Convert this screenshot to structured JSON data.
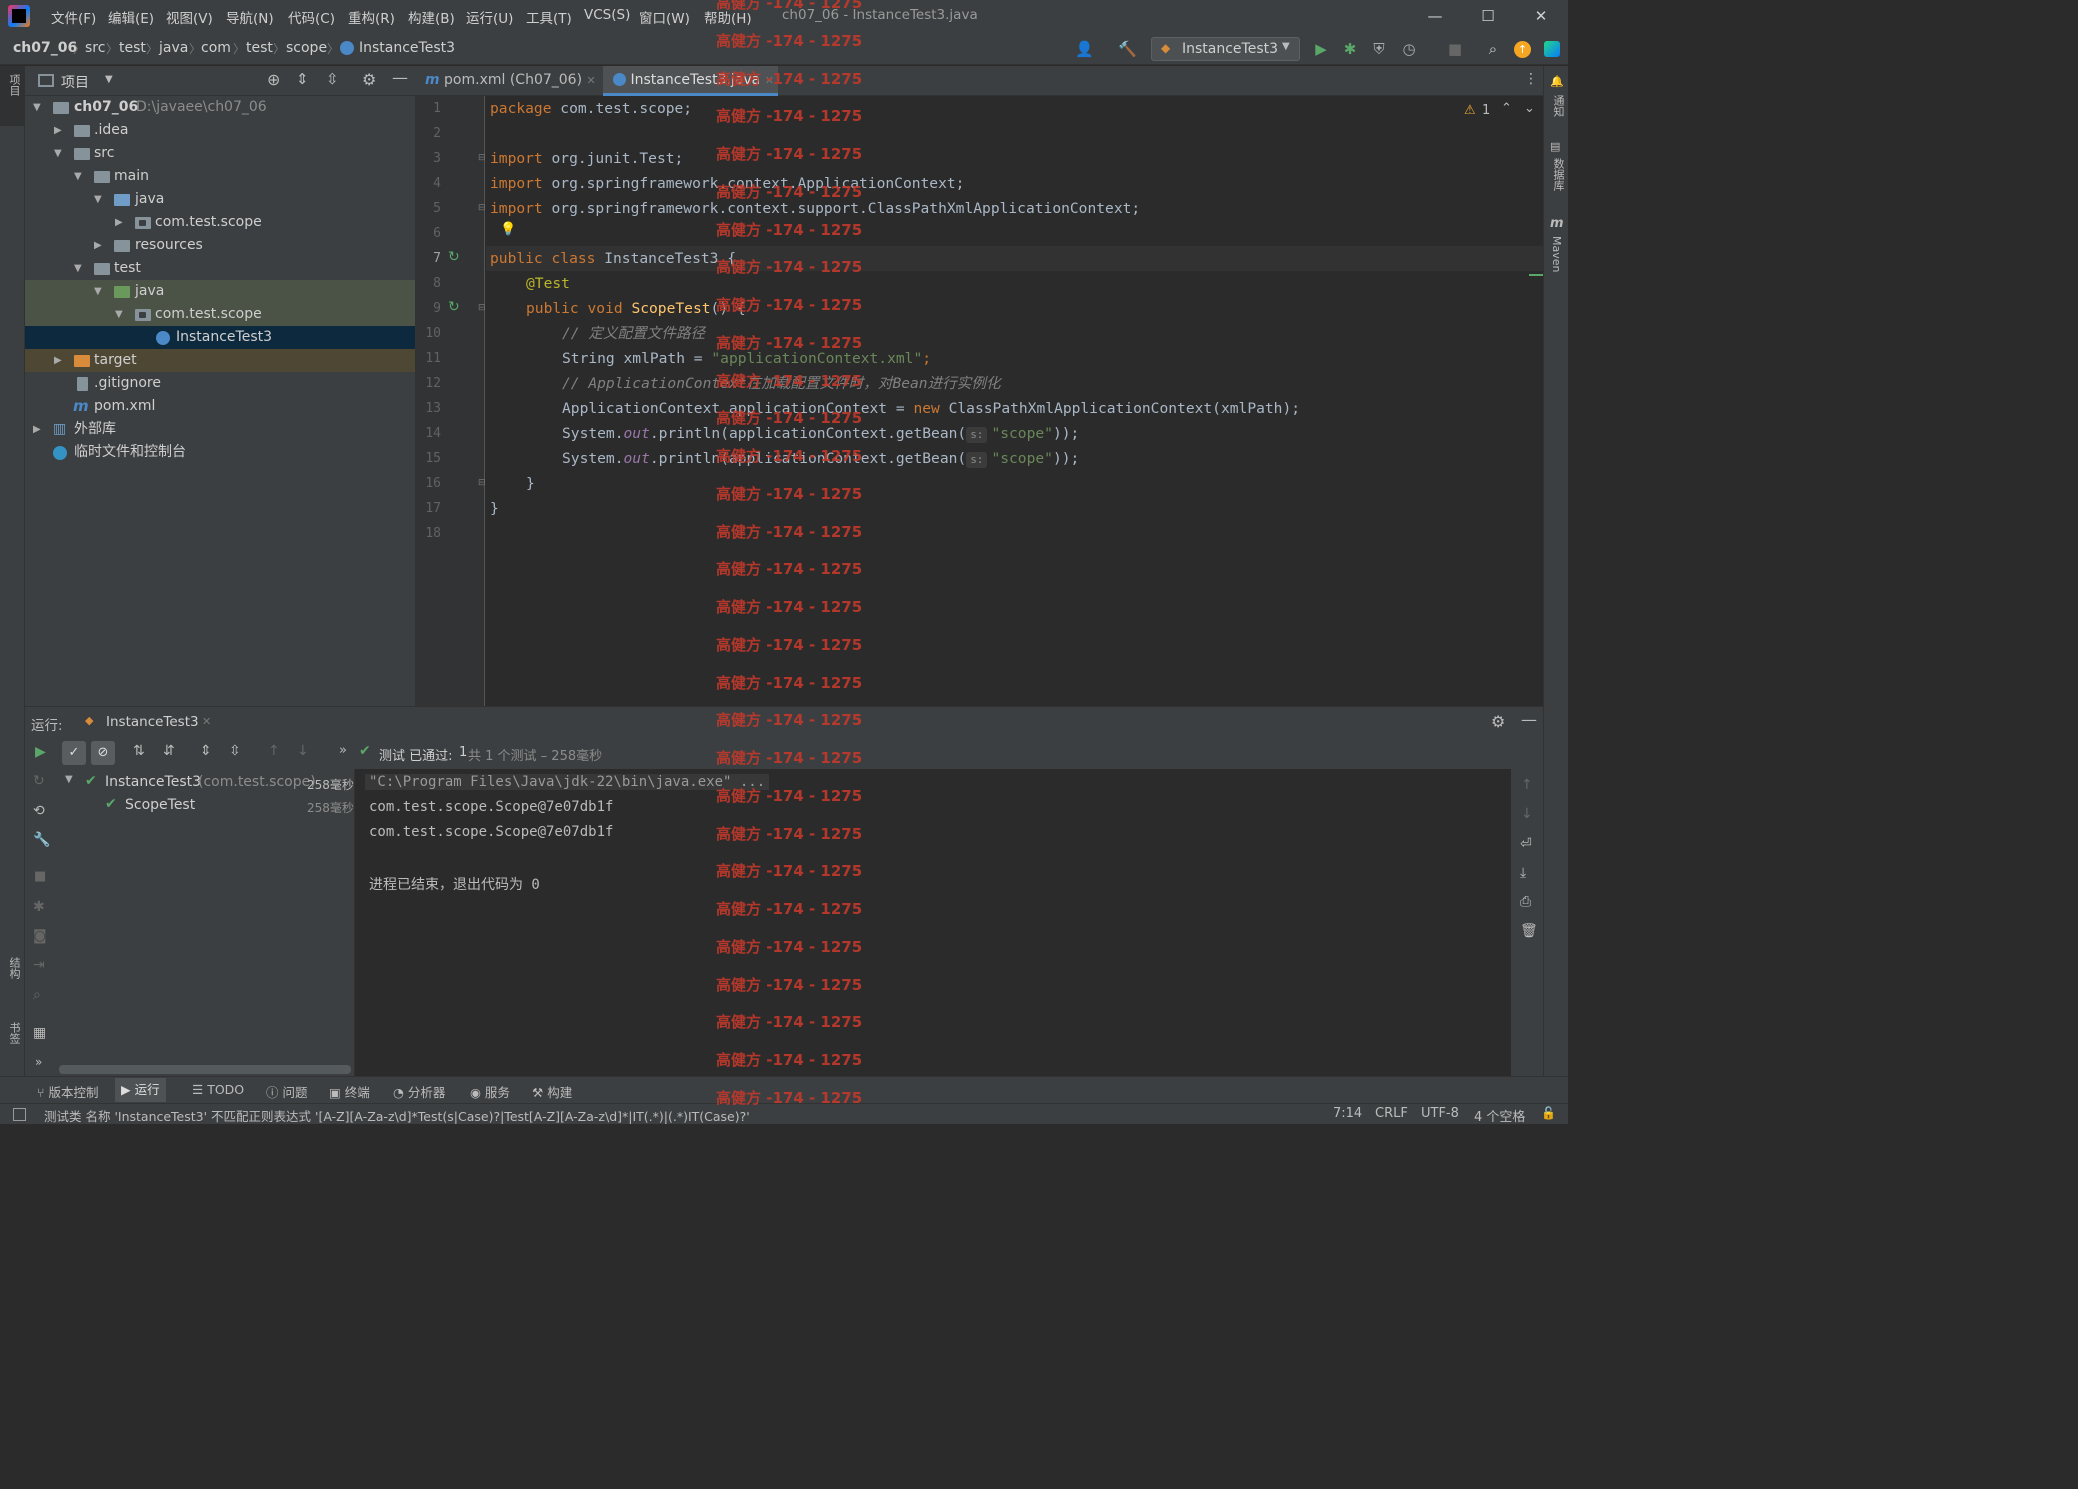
{
  "title_bar": {
    "menus": [
      "文件(F)",
      "编辑(E)",
      "视图(V)",
      "导航(N)",
      "代码(C)",
      "重构(R)",
      "构建(B)",
      "运行(U)",
      "工具(T)",
      "VCS(S)",
      "窗口(W)",
      "帮助(H)"
    ],
    "window_title": "ch07_06 - InstanceTest3.java"
  },
  "breadcrumb": [
    "ch07_06",
    "src",
    "test",
    "java",
    "com",
    "test",
    "scope",
    "InstanceTest3"
  ],
  "run_config": "InstanceTest3",
  "left_strip": {
    "project": "项目",
    "structure": "结构",
    "bookmarks": "书签"
  },
  "right_strip": {
    "notifications": "通知",
    "database": "数据库",
    "maven": "Maven"
  },
  "project_panel": {
    "title": "项目",
    "tree": [
      {
        "label": "ch07_06",
        "path": "D:\\javaee\\ch07_06"
      },
      {
        "label": ".idea"
      },
      {
        "label": "src"
      },
      {
        "label": "main"
      },
      {
        "label": "java"
      },
      {
        "label": "com.test.scope"
      },
      {
        "label": "resources"
      },
      {
        "label": "test"
      },
      {
        "label": "java"
      },
      {
        "label": "com.test.scope"
      },
      {
        "label": "InstanceTest3"
      },
      {
        "label": "target"
      },
      {
        "label": ".gitignore"
      },
      {
        "label": "pom.xml"
      },
      {
        "label": "外部库"
      },
      {
        "label": "临时文件和控制台"
      }
    ]
  },
  "editor": {
    "tabs": [
      {
        "label": "pom.xml (Ch07_06)"
      },
      {
        "label": "InstanceTest3.java"
      }
    ],
    "warnings": "1",
    "line_numbers": [
      "1",
      "2",
      "3",
      "4",
      "5",
      "6",
      "7",
      "8",
      "9",
      "10",
      "11",
      "12",
      "13",
      "14",
      "15",
      "16",
      "17",
      "18"
    ],
    "code": {
      "l1_kw": "package",
      "l1_rest": " com.test.scope;",
      "l3_kw": "import",
      "l3_rest": " org.junit.Test;",
      "l4_kw": "import",
      "l4_rest": " org.springframework.context.ApplicationContext;",
      "l5_kw": "import",
      "l5_rest": " org.springframework.context.support.ClassPathXmlApplicationContext;",
      "l7_kw": "public class",
      "l7_rest": " InstanceTest3 {",
      "l8": "@Test",
      "l9_kw": "public void",
      "l9_fn": " ScopeTest",
      "l9_rest": "() {",
      "l10": "// 定义配置文件路径",
      "l11_a": "String xmlPath = ",
      "l11_str": "\"applicationContext.xml\"",
      "l11_b": ";",
      "l12": "// ApplicationContext在加载配置文件时，对Bean进行实例化",
      "l13_a": "ApplicationContext applicationContext = ",
      "l13_kw": "new",
      "l13_b": " ClassPathXmlApplicationContext(xmlPath);",
      "l14_a": "System.",
      "l14_fld": "out",
      "l14_b": ".println(applicationContext.getBean(",
      "l14_hint": "s:",
      "l14_str": "\"scope\"",
      "l14_c": "));",
      "l15_a": "System.",
      "l15_fld": "out",
      "l15_b": ".println(applicationContext.getBean(",
      "l15_hint": "s:",
      "l15_str": "\"scope\"",
      "l15_c": "));",
      "l16": "}",
      "l17": "}"
    }
  },
  "run_panel": {
    "label": "运行:",
    "tab": "InstanceTest3",
    "status_prefix": "测试 已通过:",
    "status_count": "1",
    "status_detail": "共 1 个测试 – 258毫秒",
    "tests": [
      {
        "name": "InstanceTest3",
        "pkg": "(com.test.scope)",
        "time": "258毫秒"
      },
      {
        "name": "ScopeTest",
        "time": "258毫秒"
      }
    ],
    "console": [
      "\"C:\\Program Files\\Java\\jdk-22\\bin\\java.exe\" ...",
      "com.test.scope.Scope@7e07db1f",
      "com.test.scope.Scope@7e07db1f",
      "",
      "进程已结束，退出代码为 0"
    ]
  },
  "bottom_tabs": [
    "版本控制",
    "运行",
    "TODO",
    "问题",
    "终端",
    "分析器",
    "服务",
    "构建"
  ],
  "status_bar": {
    "message": "测试类 名称 'InstanceTest3' 不匹配正则表达式 '[A-Z][A-Za-z\\d]*Test(s|Case)?|Test[A-Z][A-Za-z\\d]*|IT(.*)|(.*)IT(Case)?'",
    "position": "7:14",
    "line_sep": "CRLF",
    "encoding": "UTF-8",
    "indent": "4 个空格"
  },
  "watermark": "高健方 -174 - 1275",
  "colors": {
    "accent": "#4a88c7",
    "keyword": "#cc7832",
    "string": "#6a8759",
    "annotation": "#bbb529",
    "watermark": "#c0392b"
  }
}
